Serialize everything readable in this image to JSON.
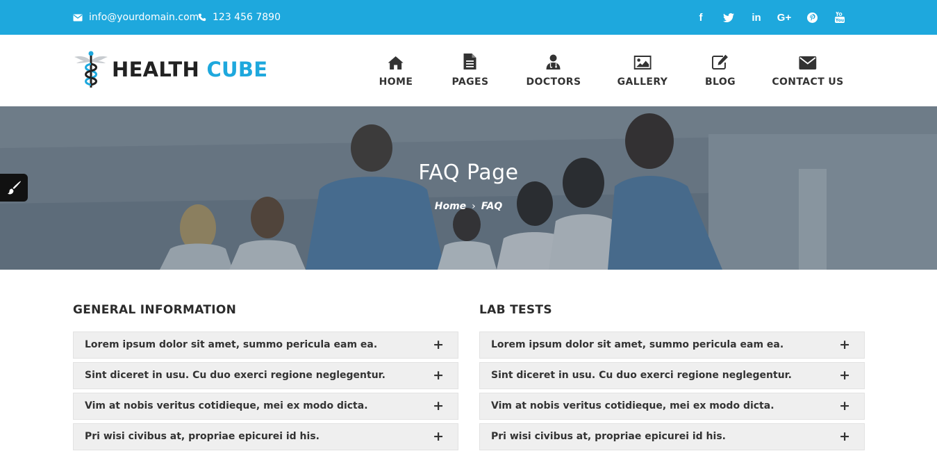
{
  "topbar": {
    "email": "info@yourdomain.com",
    "phone": "123 456 7890",
    "socials": [
      {
        "icon": "facebook-icon",
        "glyph": "f"
      },
      {
        "icon": "twitter-icon",
        "glyph": "t"
      },
      {
        "icon": "linkedin-icon",
        "glyph": "in"
      },
      {
        "icon": "google-plus-icon",
        "glyph": "G+"
      },
      {
        "icon": "pinterest-icon",
        "glyph": "P"
      },
      {
        "icon": "youtube-icon",
        "glyph": "You"
      }
    ]
  },
  "logo": {
    "part1": "HEALTH",
    "part2": "CUBE"
  },
  "nav": [
    {
      "label": "HOME",
      "icon": "home-icon"
    },
    {
      "label": "PAGES",
      "icon": "file-icon"
    },
    {
      "label": "DOCTORS",
      "icon": "user-md-icon"
    },
    {
      "label": "GALLERY",
      "icon": "image-icon"
    },
    {
      "label": "BLOG",
      "icon": "edit-icon"
    },
    {
      "label": "CONTACT US",
      "icon": "envelope-icon"
    }
  ],
  "hero": {
    "title": "FAQ Page",
    "breadcrumb": {
      "home": "Home",
      "separator": "›",
      "current": "FAQ"
    }
  },
  "faq": {
    "left": {
      "title": "GENERAL INFORMATION",
      "items": [
        "Lorem ipsum dolor sit amet, summo pericula eam ea.",
        "Sint diceret in usu. Cu duo exerci regione neglegentur.",
        "Vim at nobis veritus cotidieque, mei ex modo dicta.",
        "Pri wisi civibus at, propriae epicurei id his."
      ]
    },
    "right": {
      "title": "LAB TESTS",
      "items": [
        "Lorem ipsum dolor sit amet, summo pericula eam ea.",
        "Sint diceret in usu. Cu duo exerci regione neglegentur.",
        "Vim at nobis veritus cotidieque, mei ex modo dicta.",
        "Pri wisi civibus at, propriae epicurei id his."
      ]
    },
    "expand_symbol": "+"
  },
  "colors": {
    "accent": "#1ea8dd",
    "dark": "#222222",
    "faq_bg": "#efefef"
  }
}
